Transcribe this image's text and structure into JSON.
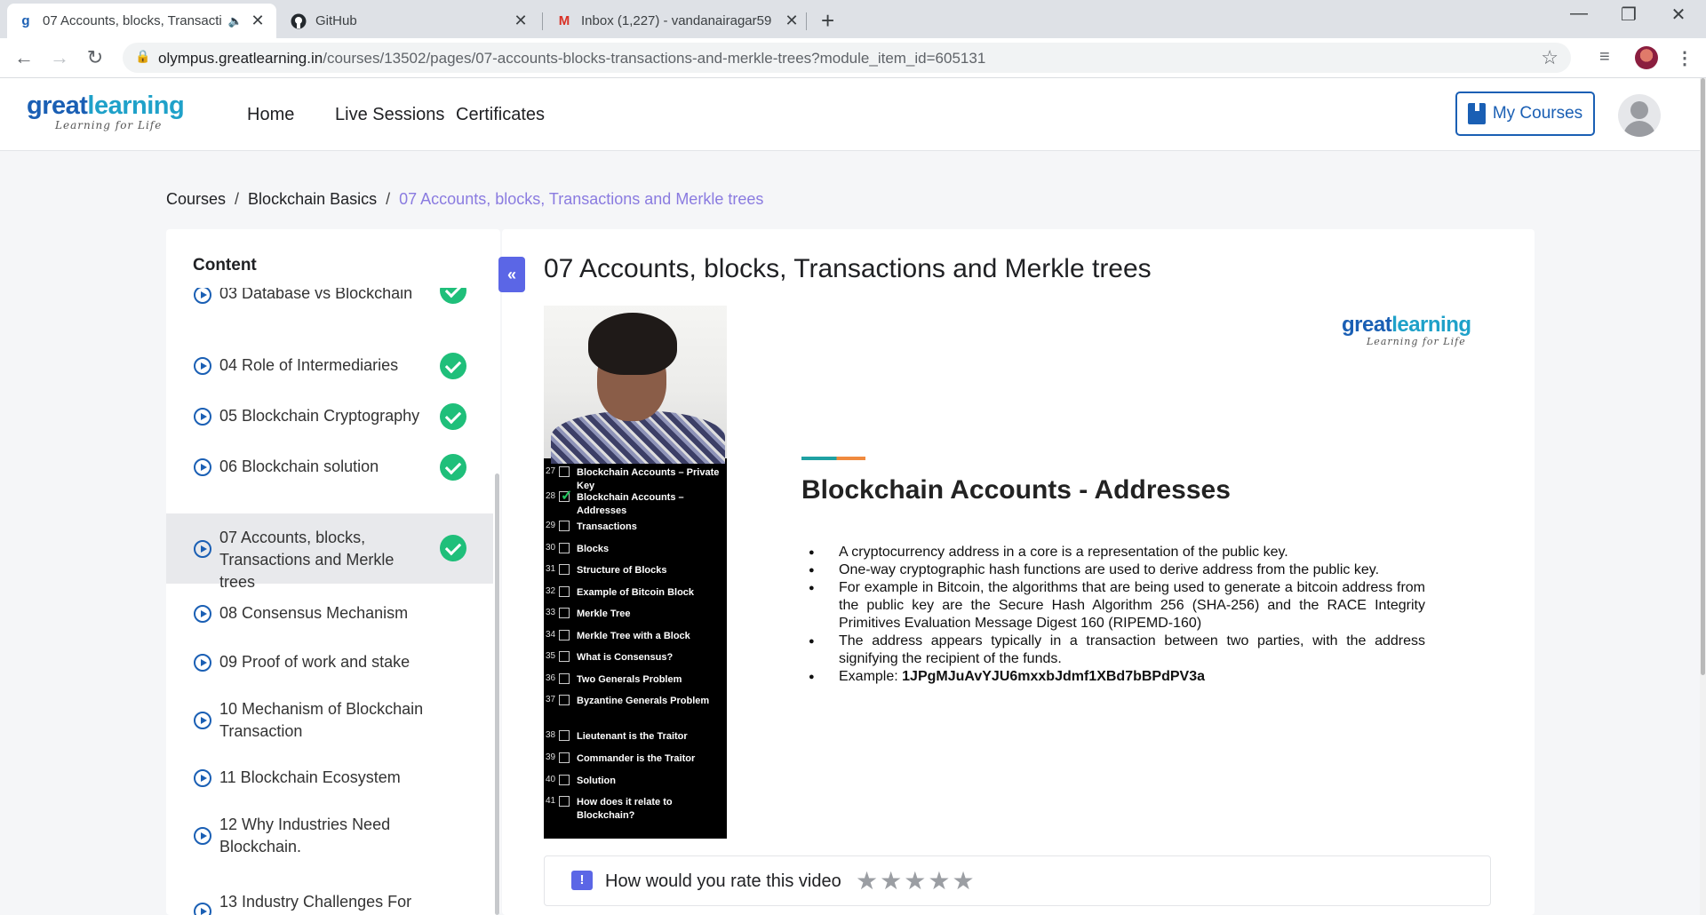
{
  "browser": {
    "tabs": [
      {
        "title": "07 Accounts, blocks, Transacti",
        "favicon": "greatlearning-favicon",
        "active": true
      },
      {
        "title": "GitHub",
        "favicon": "github-icon",
        "active": false
      },
      {
        "title": "Inbox (1,227) - vandanairagar59",
        "favicon": "gmail-icon",
        "active": false
      }
    ],
    "url_domain": "olympus.greatlearning.in",
    "url_path": "/courses/13502/pages/07-accounts-blocks-transactions-and-merkle-trees?module_item_id=605131"
  },
  "site": {
    "logo_word_a": "great",
    "logo_word_b": "learning",
    "logo_tag": "Learning for Life",
    "nav": [
      "Home",
      "Live Sessions",
      "Certificates"
    ],
    "my_courses": "My Courses"
  },
  "breadcrumb": {
    "items": [
      "Courses",
      "Blockchain Basics"
    ],
    "current": "07 Accounts, blocks, Transactions and Merkle trees",
    "separator": "/"
  },
  "sidebar": {
    "heading": "Content",
    "modules": [
      {
        "label": "03 Database vs Blockchain",
        "done": true
      },
      {
        "label": "04 Role of Intermediaries",
        "done": true
      },
      {
        "label": "05 Blockchain Cryptography",
        "done": true
      },
      {
        "label": "06 Blockchain solution",
        "done": true
      },
      {
        "label": "07 Accounts, blocks, Transactions and Merkle trees",
        "done": true,
        "active": true
      },
      {
        "label": "08 Consensus Mechanism",
        "done": false
      },
      {
        "label": "09 Proof of work and stake",
        "done": false
      },
      {
        "label": "10 Mechanism of Blockchain Transaction",
        "done": false
      },
      {
        "label": "11 Blockchain Ecosystem",
        "done": false
      },
      {
        "label": "12 Why Industries Need Blockchain.",
        "done": false
      },
      {
        "label": "13 Industry Challenges For",
        "done": false
      }
    ]
  },
  "main": {
    "title": "07 Accounts, blocks, Transactions and Merkle trees",
    "collapse_icon": "«"
  },
  "video": {
    "toc": [
      {
        "n": "27",
        "t": "Blockchain Accounts – Private Key",
        "checked": false
      },
      {
        "n": "28",
        "t": "Blockchain Accounts – Addresses",
        "checked": true
      },
      {
        "n": "29",
        "t": "Transactions",
        "checked": false
      },
      {
        "n": "30",
        "t": "Blocks",
        "checked": false
      },
      {
        "n": "31",
        "t": "Structure of Blocks",
        "checked": false
      },
      {
        "n": "32",
        "t": "Example of Bitcoin Block",
        "checked": false
      },
      {
        "n": "33",
        "t": "Merkle Tree",
        "checked": false
      },
      {
        "n": "34",
        "t": "Merkle Tree with a Block",
        "checked": false
      },
      {
        "n": "35",
        "t": "What is Consensus?",
        "checked": false
      },
      {
        "n": "36",
        "t": "Two Generals Problem",
        "checked": false
      },
      {
        "n": "37",
        "t": "Byzantine Generals Problem",
        "checked": false
      },
      {
        "n": "38",
        "t": "Lieutenant is the Traitor",
        "checked": false
      },
      {
        "n": "39",
        "t": "Commander is the Traitor",
        "checked": false
      },
      {
        "n": "40",
        "t": "Solution",
        "checked": false
      },
      {
        "n": "41",
        "t": "How does it relate to Blockchain?",
        "checked": false
      }
    ],
    "slide_title": "Blockchain Accounts - Addresses",
    "bullets": [
      "A cryptocurrency address in a core is a representation of the public key.",
      "One-way cryptographic hash functions are used to derive address from the public key.",
      "For example in Bitcoin, the algorithms that are being used to generate a bitcoin address from the public key are the Secure Hash Algorithm 256 (SHA-256) and the RACE Integrity Primitives Evaluation Message Digest 160 (RIPEMD-160)",
      "The address appears typically in a transaction between two parties, with the address signifying the recipient of the funds."
    ],
    "example_label": "Example:",
    "example_value": "1JPgMJuAvYJU6mxxbJdmf1XBd7bBPdPV3a"
  },
  "rating": {
    "question": "How would you rate this video",
    "max_stars": 5,
    "value": 0
  },
  "colors": {
    "brand": "#1a5fb4",
    "accent": "#5b66e6",
    "done": "#1fbf7a",
    "breadcrumb_current": "#8a7be0"
  }
}
